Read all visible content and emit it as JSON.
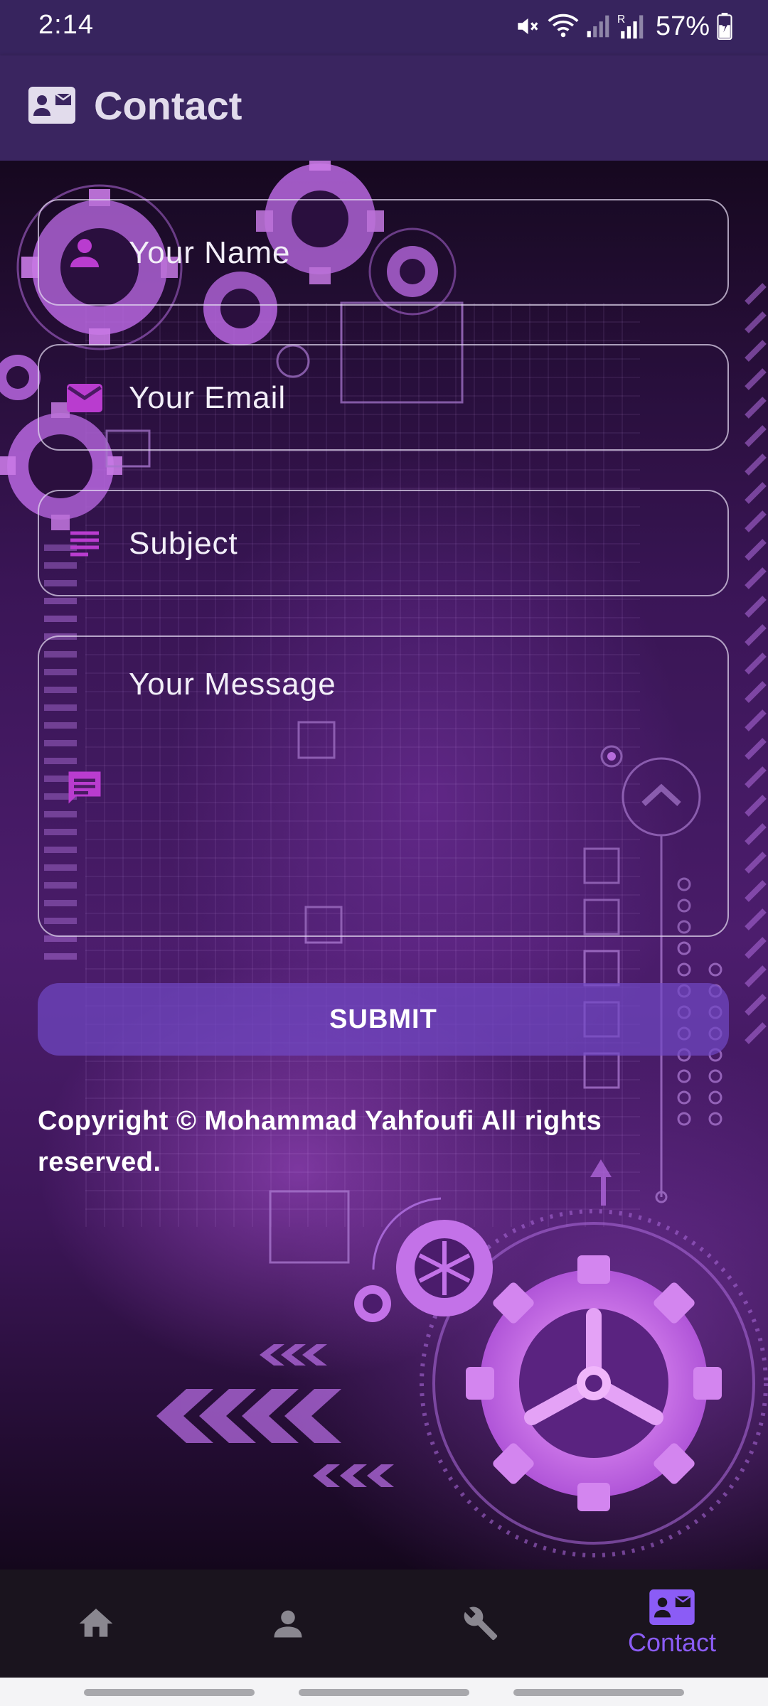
{
  "status_bar": {
    "time": "2:14",
    "battery": "57%",
    "icons": [
      "mute-icon",
      "wifi-icon",
      "signal-icon",
      "roaming-signal-icon",
      "battery-icon"
    ]
  },
  "app_bar": {
    "title": "Contact",
    "icon": "contact-card-icon"
  },
  "form": {
    "name_placeholder": "Your Name",
    "email_placeholder": "Your Email",
    "subject_placeholder": "Subject",
    "message_placeholder": "Your Message",
    "submit_label": "SUBMIT"
  },
  "footer": {
    "copyright": "Copyright © Mohammad Yahfoufi All rights reserved."
  },
  "bottom_nav": {
    "items": [
      {
        "icon": "home-icon",
        "label": ""
      },
      {
        "icon": "person-icon",
        "label": ""
      },
      {
        "icon": "wrench-icon",
        "label": ""
      },
      {
        "icon": "contact-card-icon",
        "label": "Contact",
        "active": true
      }
    ]
  },
  "colors": {
    "app_bar": "#3a2560",
    "accent": "#8b5cf6",
    "field_icon": "#b93ccf"
  }
}
